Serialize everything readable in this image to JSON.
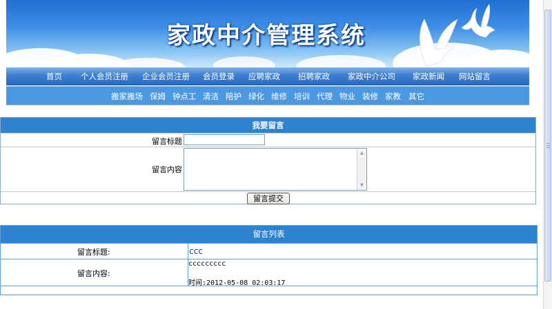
{
  "header": {
    "title": "家政中介管理系统"
  },
  "nav_main": [
    "首页",
    "个人会员注册",
    "企业会员注册",
    "会员登录",
    "应聘家政",
    "招聘家政",
    "家政中介公司",
    "家政新闻",
    "网站留言"
  ],
  "nav_sub": [
    "搬家搬场",
    "保姆",
    "钟点工",
    "清洁",
    "陪护",
    "绿化",
    "维修",
    "培训",
    "代理",
    "物业",
    "装修",
    "家教",
    "其它"
  ],
  "form": {
    "heading": "我要留言",
    "title_label": "留言标题",
    "content_label": "留言内容",
    "title_value": "",
    "content_value": "",
    "submit_label": "留言提交"
  },
  "list": {
    "heading": "留言列表",
    "title_label": "留言标题:",
    "content_label": "留言内容:",
    "entries": [
      {
        "title": "ccc",
        "content": "ccccccccc",
        "time": "时间:2012-05-08 02:03:17"
      }
    ]
  },
  "colors": {
    "banner": "#3e8fe6",
    "nav_main": "#3f7fd0",
    "nav_sub": "#4a98e2",
    "section_head": "#2d83cf",
    "link": "#1a3ea8"
  },
  "icons": [
    "dove-icon",
    "scroll-up-arrow-icon",
    "scroll-down-arrow-icon"
  ]
}
